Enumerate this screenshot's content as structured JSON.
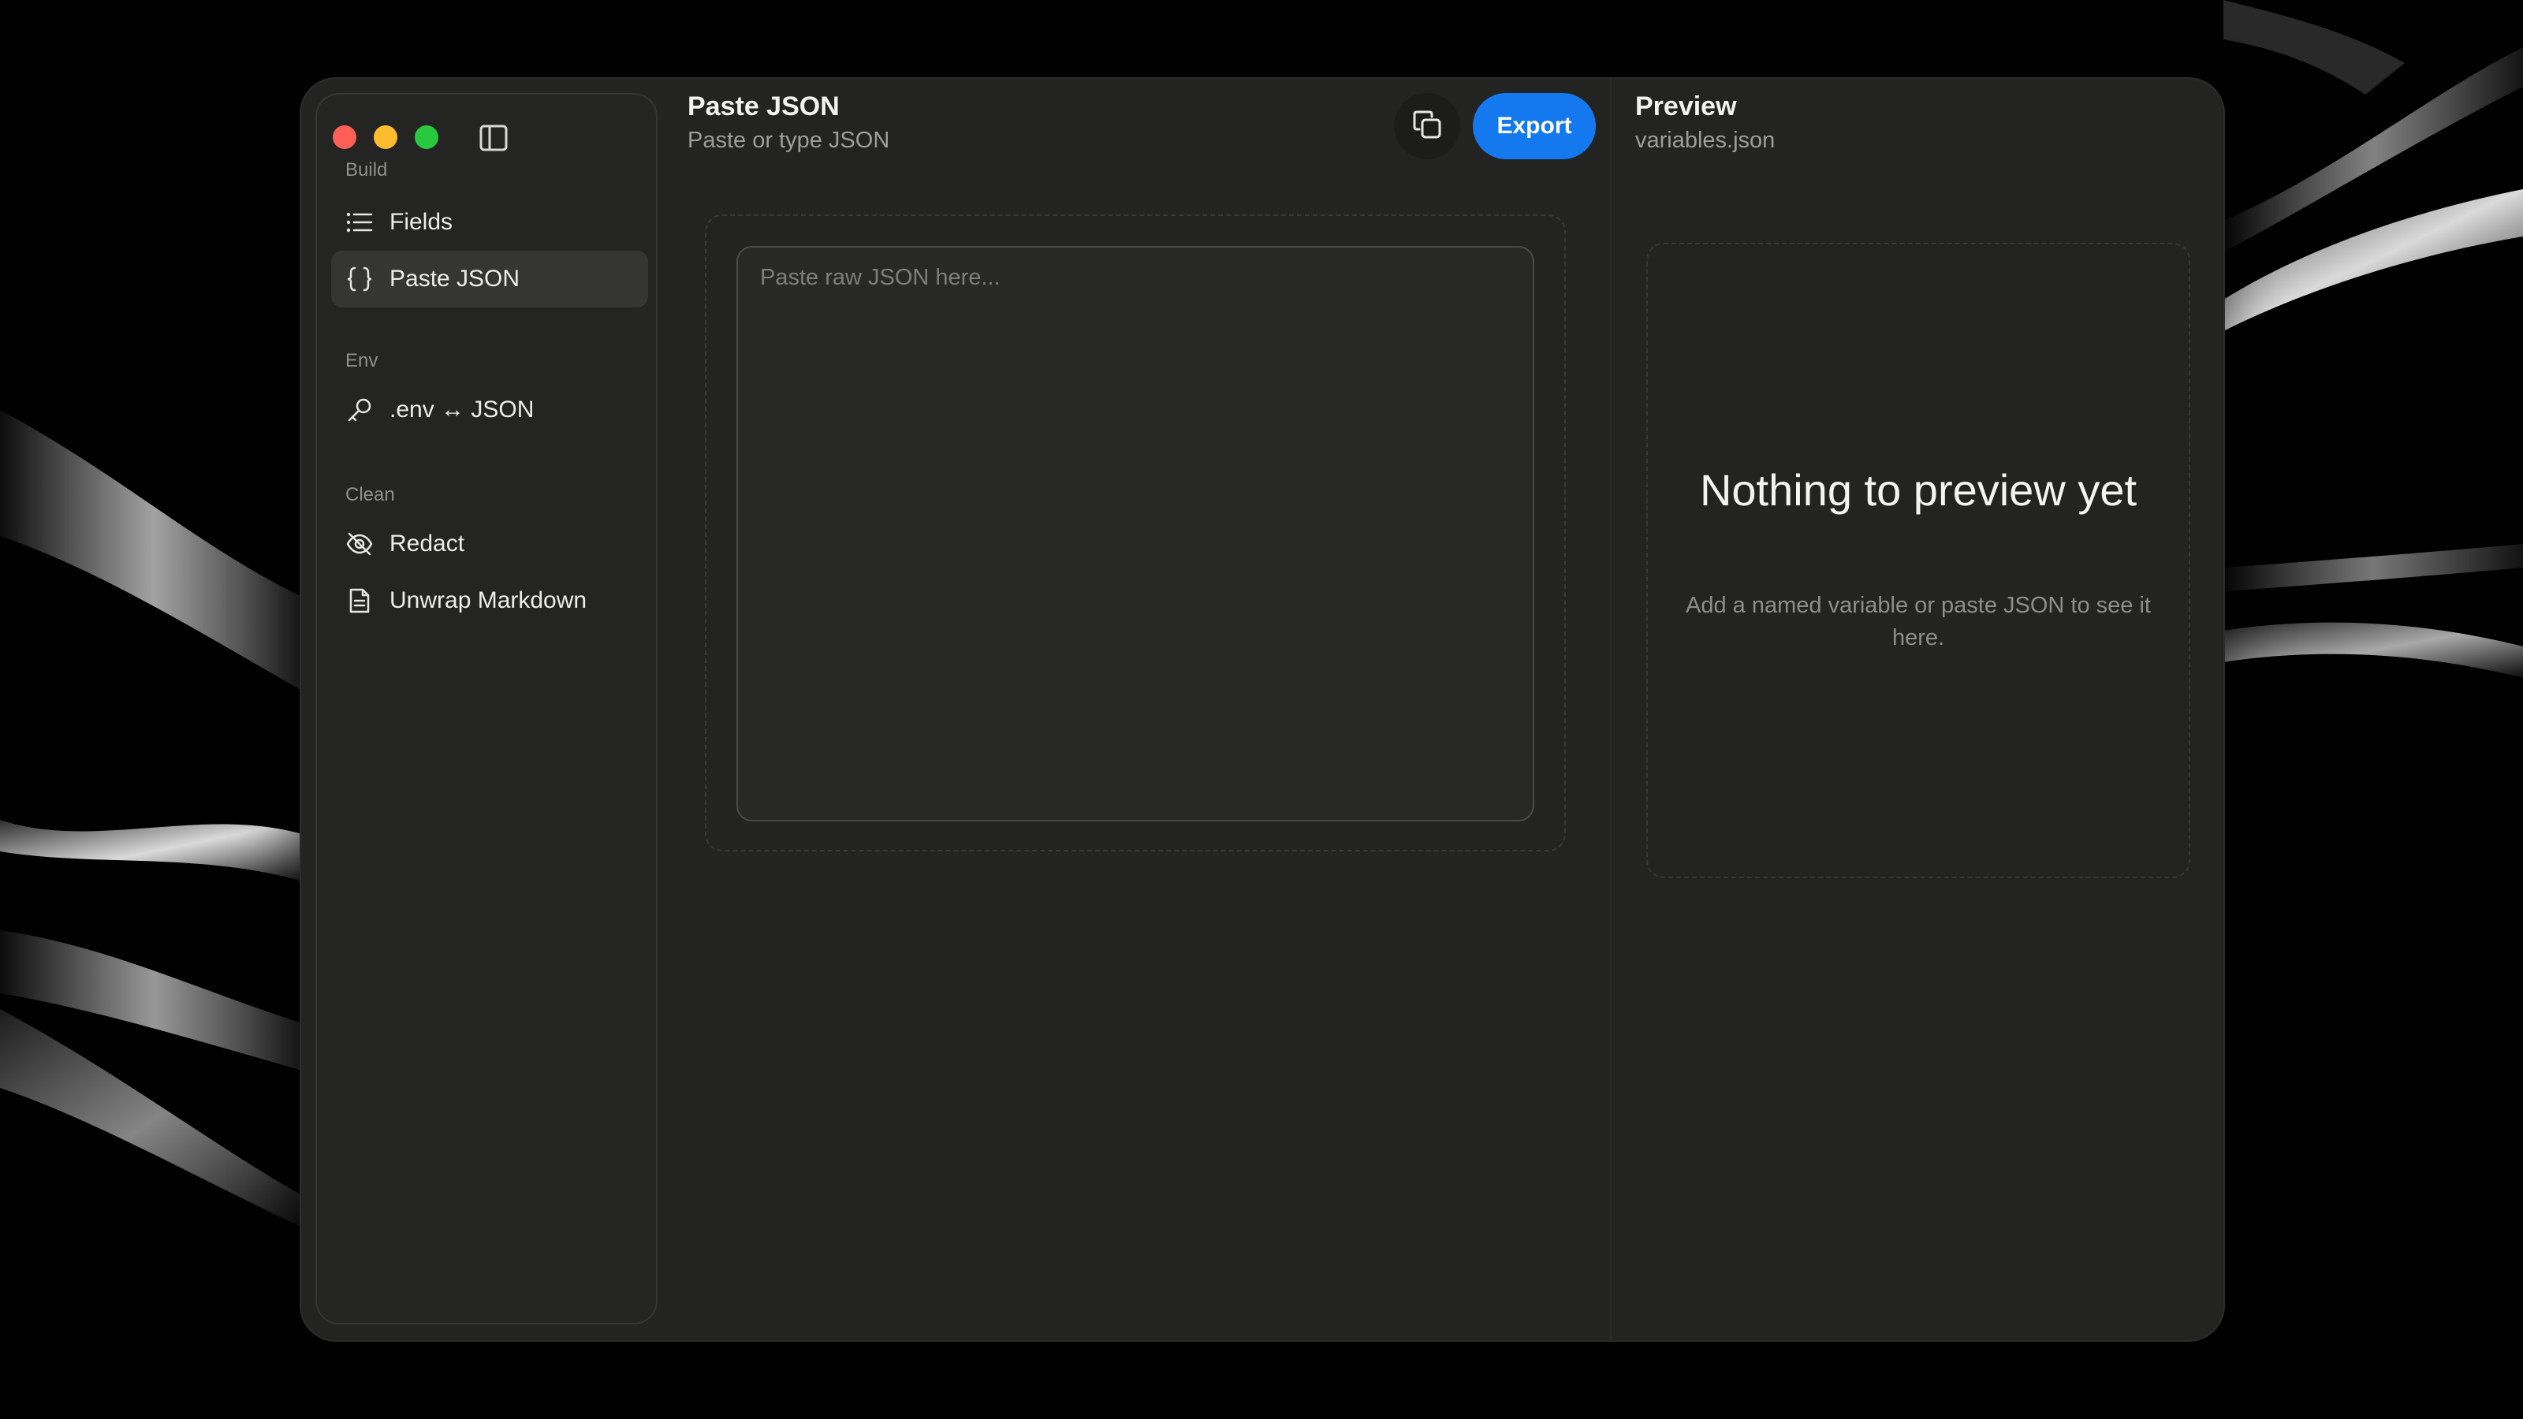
{
  "sidebar": {
    "sections": [
      {
        "label": "Build",
        "items": [
          {
            "label": "Fields",
            "icon": "list-icon"
          },
          {
            "label": "Paste JSON",
            "icon": "braces-icon",
            "active": true
          }
        ]
      },
      {
        "label": "Env",
        "items": [
          {
            "label": ".env ↔ JSON",
            "icon": "key-icon"
          }
        ]
      },
      {
        "label": "Clean",
        "items": [
          {
            "label": "Redact",
            "icon": "eye-off-icon"
          },
          {
            "label": "Unwrap Markdown",
            "icon": "document-icon"
          }
        ]
      }
    ]
  },
  "header": {
    "title": "Paste JSON",
    "subtitle": "Paste or type JSON",
    "copy_icon": "copy-icon",
    "export_label": "Export"
  },
  "editor": {
    "value": "",
    "placeholder": "Paste raw JSON here..."
  },
  "preview": {
    "title": "Preview",
    "filename": "variables.json",
    "empty_heading": "Nothing to preview yet",
    "empty_text": "Add a named variable or paste JSON to see it here."
  },
  "colors": {
    "accent": "#1479ee",
    "close": "#fe5f57",
    "minimize": "#febc2e",
    "zoom": "#28c840",
    "window_bg": "#232321"
  }
}
